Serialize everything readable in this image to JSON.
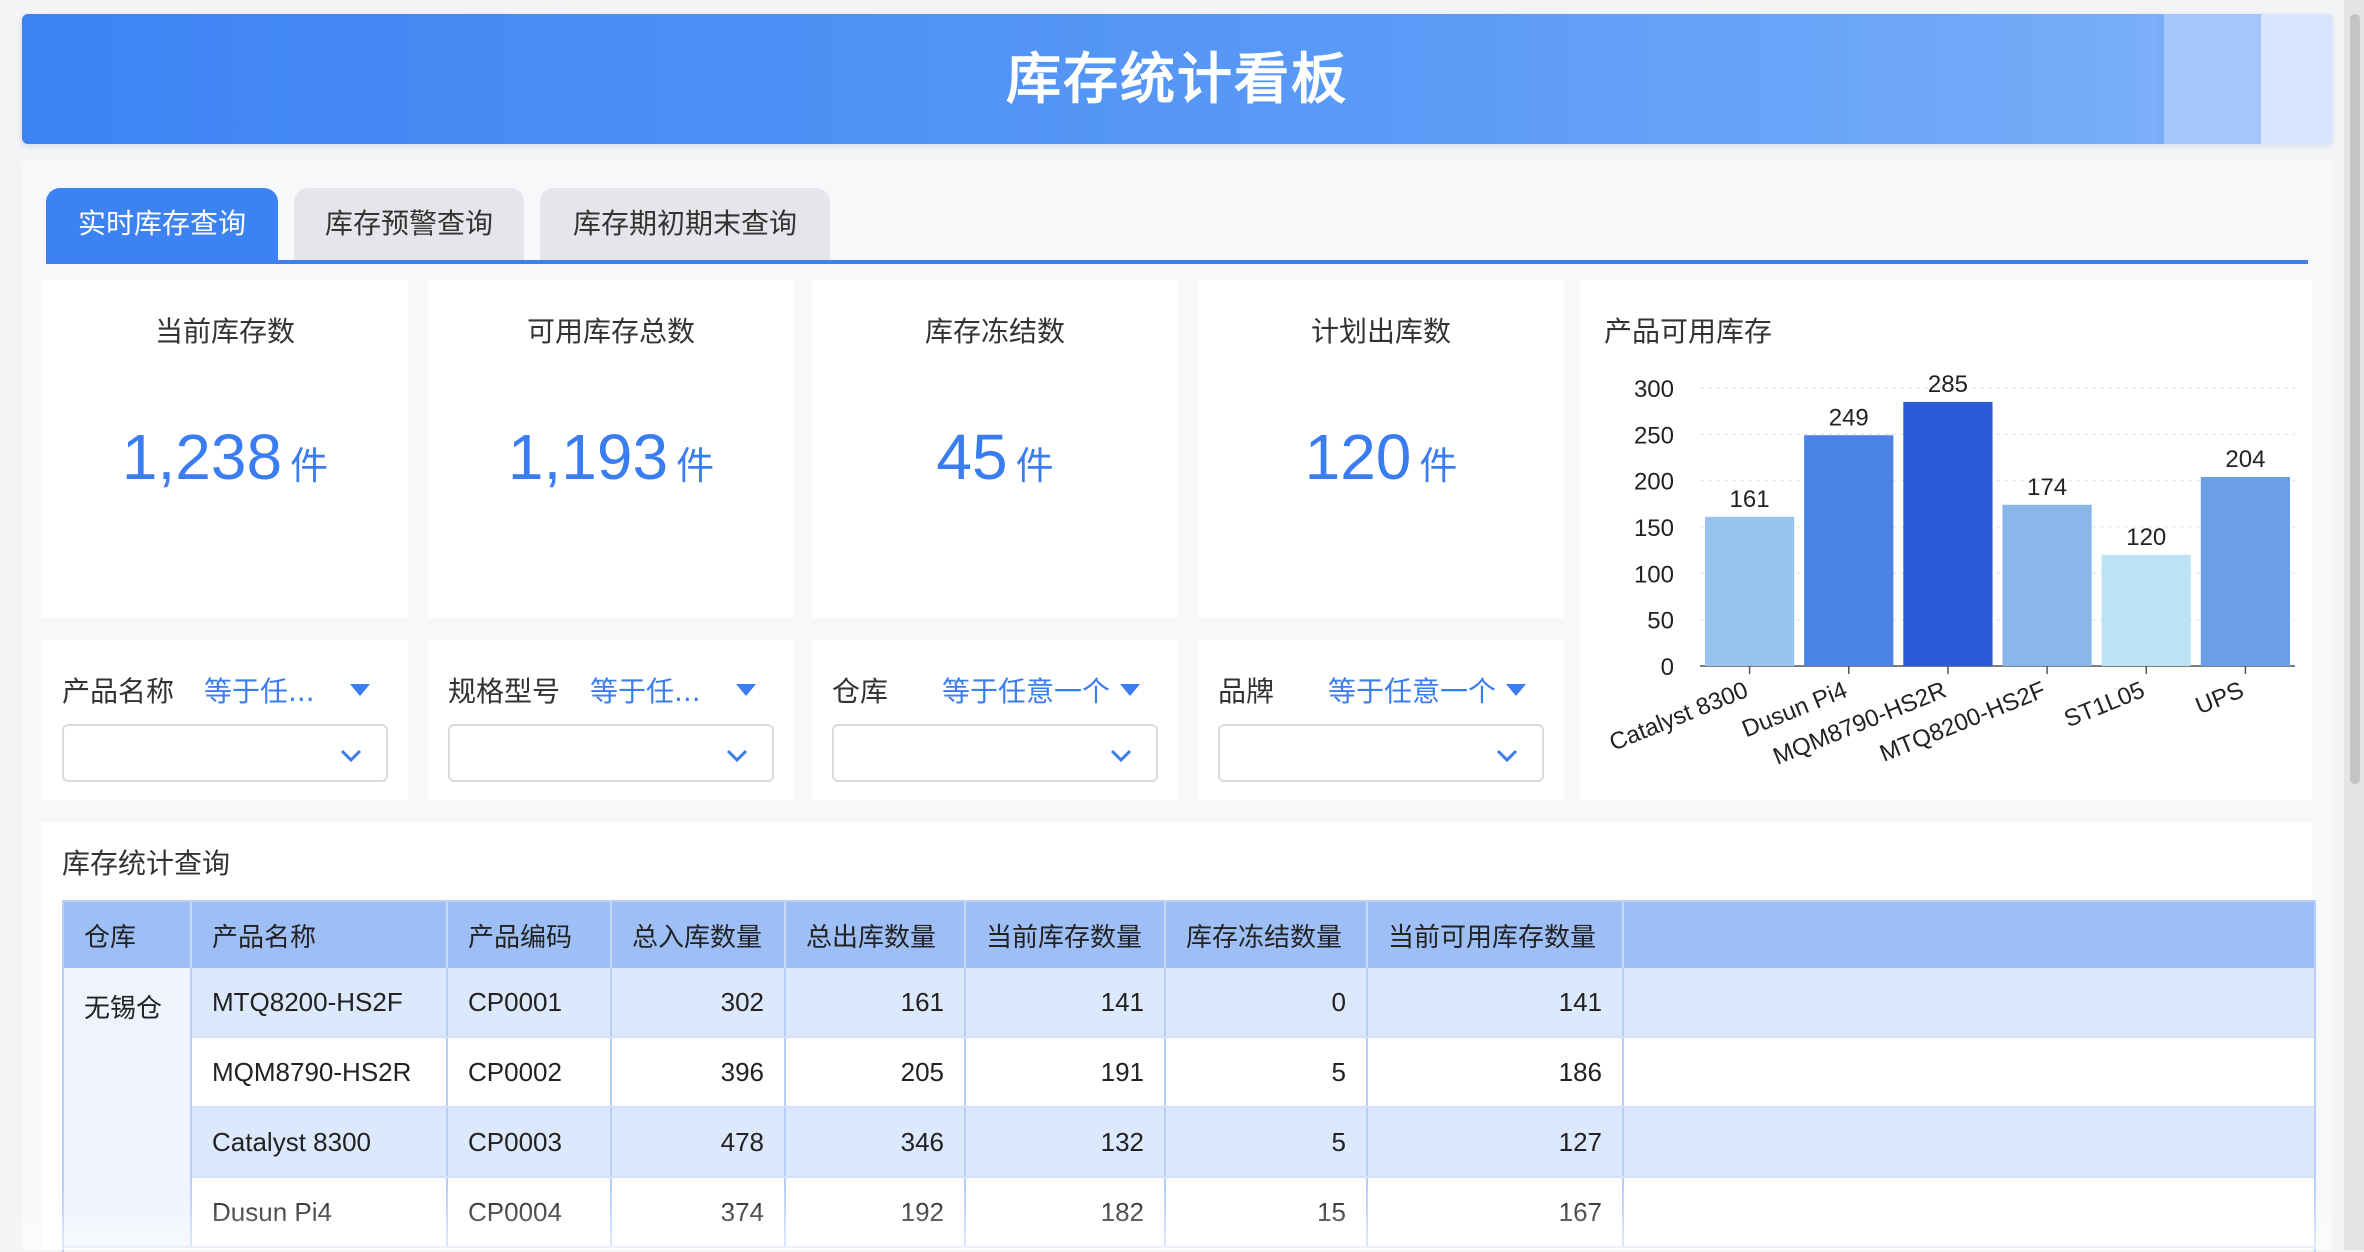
{
  "header": {
    "title": "库存统计看板"
  },
  "tabs": [
    {
      "label": "实时库存查询",
      "active": true
    },
    {
      "label": "库存预警查询",
      "active": false
    },
    {
      "label": "库存期初期末查询",
      "active": false
    }
  ],
  "kpis": [
    {
      "title": "当前库存数",
      "value": "1,238",
      "unit": "件"
    },
    {
      "title": "可用库存总数",
      "value": "1,193",
      "unit": "件"
    },
    {
      "title": "库存冻结数",
      "value": "45",
      "unit": "件"
    },
    {
      "title": "计划出库数",
      "value": "120",
      "unit": "件"
    }
  ],
  "filters": [
    {
      "label": "产品名称",
      "operator": "等于任...",
      "value": ""
    },
    {
      "label": "规格型号",
      "operator": "等于任...",
      "value": ""
    },
    {
      "label": "仓库",
      "operator": "等于任意一个",
      "value": ""
    },
    {
      "label": "品牌",
      "operator": "等于任意一个",
      "value": ""
    }
  ],
  "chart_data": {
    "type": "bar",
    "title": "产品可用库存",
    "categories": [
      "Catalyst 8300",
      "Dusun Pi4",
      "MQM8790-HS2R",
      "MTQ8200-HS2F",
      "ST1L05",
      "UPS"
    ],
    "values": [
      161,
      249,
      285,
      174,
      120,
      204
    ],
    "colors": [
      "#97c3ee",
      "#4a83e2",
      "#2a5cd8",
      "#8ab7ea",
      "#bce3f4",
      "#6d9fe6"
    ],
    "yticks": [
      "0",
      "50",
      "100",
      "150",
      "200",
      "250",
      "300"
    ],
    "ylim": [
      0,
      300
    ],
    "grid": true,
    "xlabel": "",
    "ylabel": ""
  },
  "table": {
    "title": "库存统计查询",
    "headers": [
      "仓库",
      "产品名称",
      "产品编码",
      "总入库数量",
      "总出库数量",
      "当前库存数量",
      "库存冻结数量",
      "当前可用库存数量"
    ],
    "warehouse": "无锡仓",
    "rows": [
      [
        "MTQ8200-HS2F",
        "CP0001",
        "302",
        "161",
        "141",
        "0",
        "141"
      ],
      [
        "MQM8790-HS2R",
        "CP0002",
        "396",
        "205",
        "191",
        "5",
        "186"
      ],
      [
        "Catalyst 8300",
        "CP0003",
        "478",
        "346",
        "132",
        "5",
        "127"
      ],
      [
        "Dusun Pi4",
        "CP0004",
        "374",
        "192",
        "182",
        "15",
        "167"
      ]
    ]
  }
}
